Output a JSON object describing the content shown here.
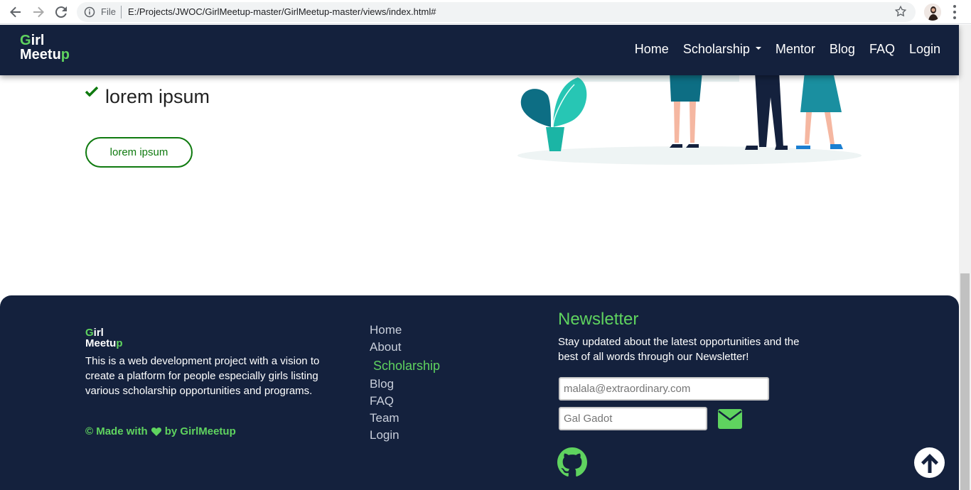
{
  "browser": {
    "file_label": "File",
    "url": "E:/Projects/JWOC/GirlMeetup-master/GirlMeetup-master/views/index.html#"
  },
  "navbar": {
    "logo_line1": "Girl",
    "logo_line2": "Meetup",
    "links": [
      "Home",
      "Scholarship",
      "Mentor",
      "Blog",
      "FAQ",
      "Login"
    ]
  },
  "hero": {
    "item_text": "lorem ipsum",
    "button_label": "lorem ipsum"
  },
  "footer": {
    "logo_line1": "Girl",
    "logo_line2": "Meetup",
    "description": "This is a web development project with a vision to create a platform for people especially girls listing various scholarship opportunities and programs.",
    "made_prefix": "© Made with",
    "made_suffix": "by GirlMeetup",
    "links": [
      "Home",
      "About",
      "Scholarship",
      "Blog",
      "FAQ",
      "Team",
      "Login"
    ],
    "newsletter": {
      "title": "Newsletter",
      "text": "Stay updated about the latest opportunities and the best of all words through our Newsletter!",
      "email_placeholder": "malala@extraordinary.com",
      "name_placeholder": "Gal Gadot"
    }
  },
  "colors": {
    "navy": "#14213d",
    "green": "#5fd35f",
    "dark_green": "#0f7a0f"
  }
}
